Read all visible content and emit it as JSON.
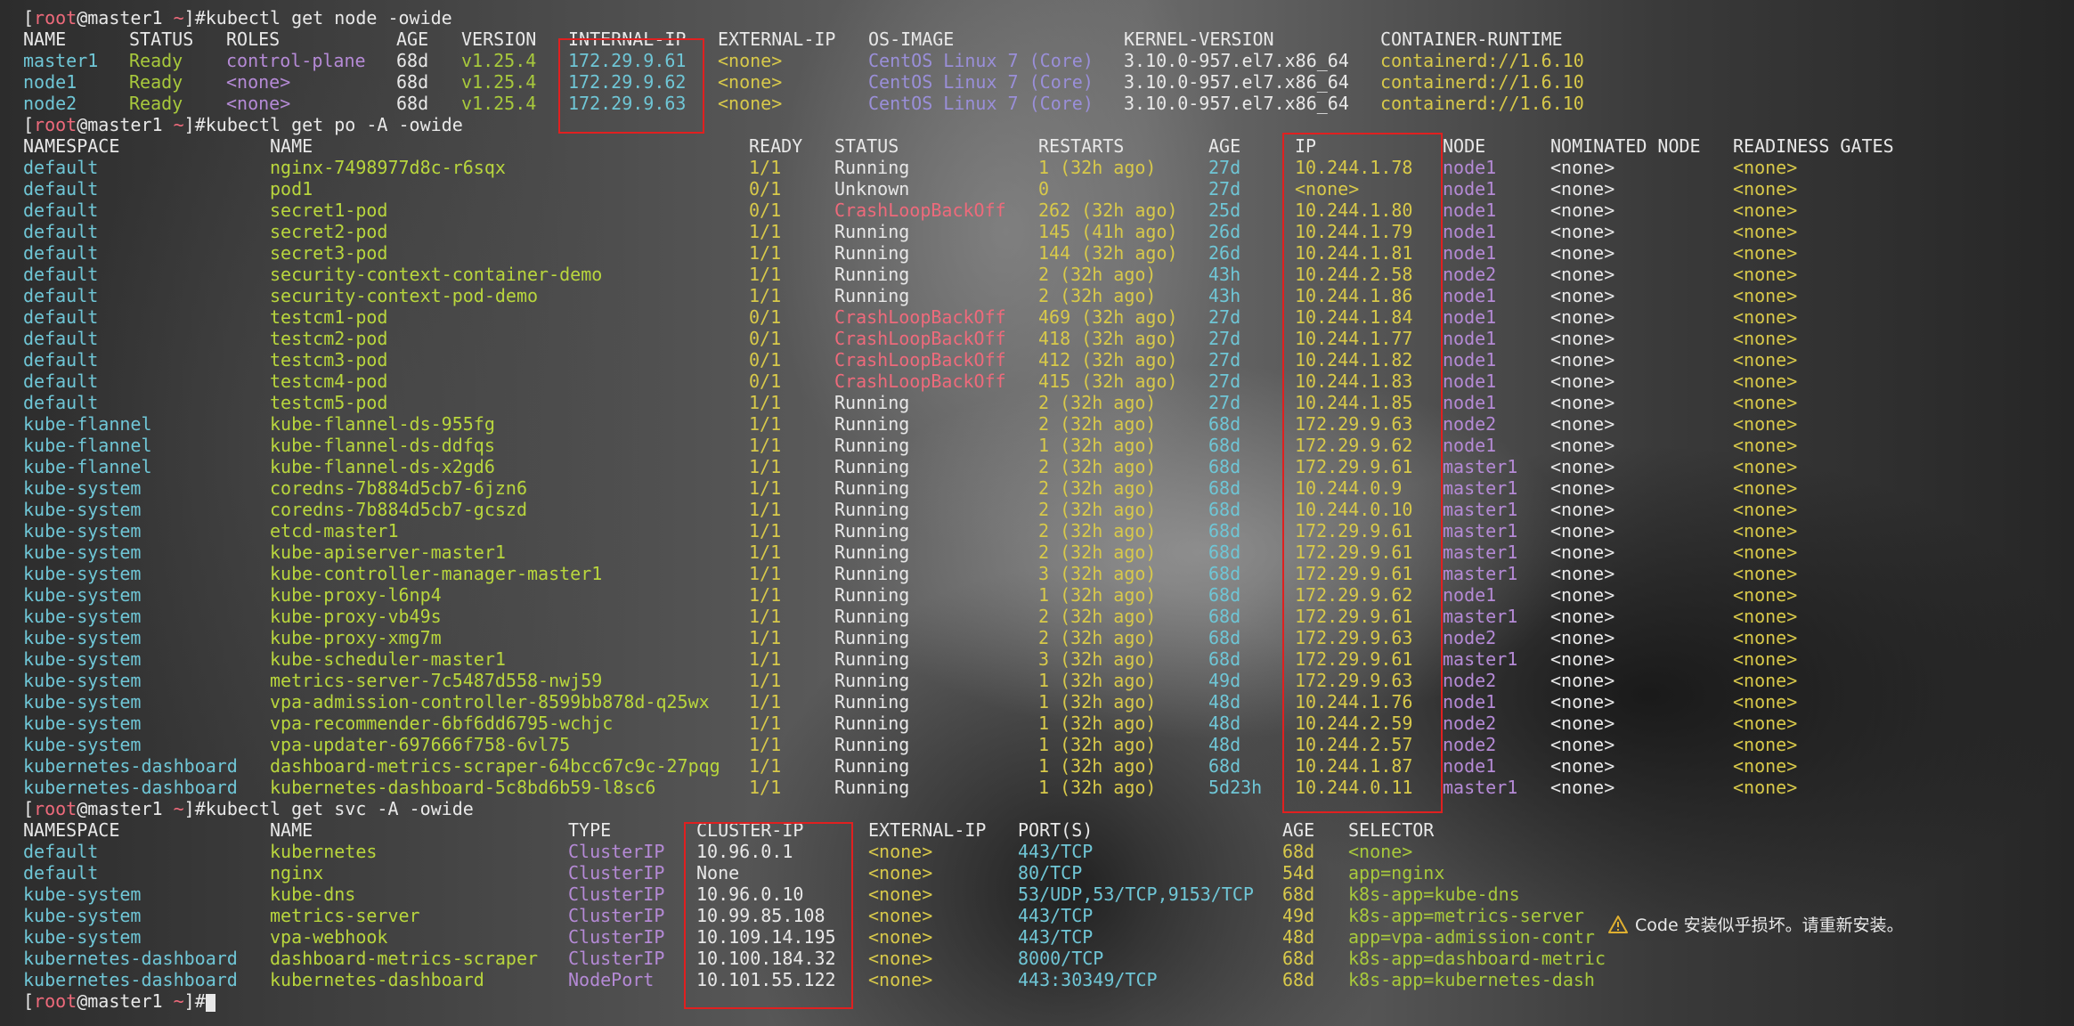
{
  "prompt": {
    "user": "root",
    "host": "master1",
    "dir": "~"
  },
  "cmd1": "kubectl get node -owide",
  "node_headers": [
    "NAME",
    "STATUS",
    "ROLES",
    "AGE",
    "VERSION",
    "INTERNAL-IP",
    "EXTERNAL-IP",
    "OS-IMAGE",
    "KERNEL-VERSION",
    "CONTAINER-RUNTIME"
  ],
  "nodes": [
    [
      "master1",
      "Ready",
      "control-plane",
      "68d",
      "v1.25.4",
      "172.29.9.61",
      "<none>",
      "CentOS Linux 7 (Core)",
      "3.10.0-957.el7.x86_64",
      "containerd://1.6.10"
    ],
    [
      "node1",
      "Ready",
      "<none>",
      "68d",
      "v1.25.4",
      "172.29.9.62",
      "<none>",
      "CentOS Linux 7 (Core)",
      "3.10.0-957.el7.x86_64",
      "containerd://1.6.10"
    ],
    [
      "node2",
      "Ready",
      "<none>",
      "68d",
      "v1.25.4",
      "172.29.9.63",
      "<none>",
      "CentOS Linux 7 (Core)",
      "3.10.0-957.el7.x86_64",
      "containerd://1.6.10"
    ]
  ],
  "cmd2": "kubectl get po -A -owide",
  "pod_headers": [
    "NAMESPACE",
    "NAME",
    "READY",
    "STATUS",
    "RESTARTS",
    "AGE",
    "IP",
    "NODE",
    "NOMINATED NODE",
    "READINESS GATES"
  ],
  "pods": [
    [
      "default",
      "nginx-7498977d8c-r6sqx",
      "1/1",
      "Running",
      "1 (32h ago)",
      "27d",
      "10.244.1.78",
      "node1",
      "<none>",
      "<none>"
    ],
    [
      "default",
      "pod1",
      "0/1",
      "Unknown",
      "0",
      "27d",
      "<none>",
      "node1",
      "<none>",
      "<none>"
    ],
    [
      "default",
      "secret1-pod",
      "0/1",
      "CrashLoopBackOff",
      "262 (32h ago)",
      "25d",
      "10.244.1.80",
      "node1",
      "<none>",
      "<none>"
    ],
    [
      "default",
      "secret2-pod",
      "1/1",
      "Running",
      "145 (41h ago)",
      "26d",
      "10.244.1.79",
      "node1",
      "<none>",
      "<none>"
    ],
    [
      "default",
      "secret3-pod",
      "1/1",
      "Running",
      "144 (32h ago)",
      "26d",
      "10.244.1.81",
      "node1",
      "<none>",
      "<none>"
    ],
    [
      "default",
      "security-context-container-demo",
      "1/1",
      "Running",
      "2 (32h ago)",
      "43h",
      "10.244.2.58",
      "node2",
      "<none>",
      "<none>"
    ],
    [
      "default",
      "security-context-pod-demo",
      "1/1",
      "Running",
      "2 (32h ago)",
      "43h",
      "10.244.1.86",
      "node1",
      "<none>",
      "<none>"
    ],
    [
      "default",
      "testcm1-pod",
      "0/1",
      "CrashLoopBackOff",
      "469 (32h ago)",
      "27d",
      "10.244.1.84",
      "node1",
      "<none>",
      "<none>"
    ],
    [
      "default",
      "testcm2-pod",
      "0/1",
      "CrashLoopBackOff",
      "418 (32h ago)",
      "27d",
      "10.244.1.77",
      "node1",
      "<none>",
      "<none>"
    ],
    [
      "default",
      "testcm3-pod",
      "0/1",
      "CrashLoopBackOff",
      "412 (32h ago)",
      "27d",
      "10.244.1.82",
      "node1",
      "<none>",
      "<none>"
    ],
    [
      "default",
      "testcm4-pod",
      "0/1",
      "CrashLoopBackOff",
      "415 (32h ago)",
      "27d",
      "10.244.1.83",
      "node1",
      "<none>",
      "<none>"
    ],
    [
      "default",
      "testcm5-pod",
      "1/1",
      "Running",
      "2 (32h ago)",
      "27d",
      "10.244.1.85",
      "node1",
      "<none>",
      "<none>"
    ],
    [
      "kube-flannel",
      "kube-flannel-ds-955fg",
      "1/1",
      "Running",
      "2 (32h ago)",
      "68d",
      "172.29.9.63",
      "node2",
      "<none>",
      "<none>"
    ],
    [
      "kube-flannel",
      "kube-flannel-ds-ddfqs",
      "1/1",
      "Running",
      "1 (32h ago)",
      "68d",
      "172.29.9.62",
      "node1",
      "<none>",
      "<none>"
    ],
    [
      "kube-flannel",
      "kube-flannel-ds-x2gd6",
      "1/1",
      "Running",
      "2 (32h ago)",
      "68d",
      "172.29.9.61",
      "master1",
      "<none>",
      "<none>"
    ],
    [
      "kube-system",
      "coredns-7b884d5cb7-6jzn6",
      "1/1",
      "Running",
      "2 (32h ago)",
      "68d",
      "10.244.0.9",
      "master1",
      "<none>",
      "<none>"
    ],
    [
      "kube-system",
      "coredns-7b884d5cb7-gcszd",
      "1/1",
      "Running",
      "2 (32h ago)",
      "68d",
      "10.244.0.10",
      "master1",
      "<none>",
      "<none>"
    ],
    [
      "kube-system",
      "etcd-master1",
      "1/1",
      "Running",
      "2 (32h ago)",
      "68d",
      "172.29.9.61",
      "master1",
      "<none>",
      "<none>"
    ],
    [
      "kube-system",
      "kube-apiserver-master1",
      "1/1",
      "Running",
      "2 (32h ago)",
      "68d",
      "172.29.9.61",
      "master1",
      "<none>",
      "<none>"
    ],
    [
      "kube-system",
      "kube-controller-manager-master1",
      "1/1",
      "Running",
      "3 (32h ago)",
      "68d",
      "172.29.9.61",
      "master1",
      "<none>",
      "<none>"
    ],
    [
      "kube-system",
      "kube-proxy-l6np4",
      "1/1",
      "Running",
      "1 (32h ago)",
      "68d",
      "172.29.9.62",
      "node1",
      "<none>",
      "<none>"
    ],
    [
      "kube-system",
      "kube-proxy-vb49s",
      "1/1",
      "Running",
      "2 (32h ago)",
      "68d",
      "172.29.9.61",
      "master1",
      "<none>",
      "<none>"
    ],
    [
      "kube-system",
      "kube-proxy-xmg7m",
      "1/1",
      "Running",
      "2 (32h ago)",
      "68d",
      "172.29.9.63",
      "node2",
      "<none>",
      "<none>"
    ],
    [
      "kube-system",
      "kube-scheduler-master1",
      "1/1",
      "Running",
      "3 (32h ago)",
      "68d",
      "172.29.9.61",
      "master1",
      "<none>",
      "<none>"
    ],
    [
      "kube-system",
      "metrics-server-7c5487d558-nwj59",
      "1/1",
      "Running",
      "1 (32h ago)",
      "49d",
      "172.29.9.63",
      "node2",
      "<none>",
      "<none>"
    ],
    [
      "kube-system",
      "vpa-admission-controller-8599bb878d-q25wx",
      "1/1",
      "Running",
      "1 (32h ago)",
      "48d",
      "10.244.1.76",
      "node1",
      "<none>",
      "<none>"
    ],
    [
      "kube-system",
      "vpa-recommender-6bf6dd6795-wchjc",
      "1/1",
      "Running",
      "1 (32h ago)",
      "48d",
      "10.244.2.59",
      "node2",
      "<none>",
      "<none>"
    ],
    [
      "kube-system",
      "vpa-updater-697666f758-6vl75",
      "1/1",
      "Running",
      "1 (32h ago)",
      "48d",
      "10.244.2.57",
      "node2",
      "<none>",
      "<none>"
    ],
    [
      "kubernetes-dashboard",
      "dashboard-metrics-scraper-64bcc67c9c-27pqg",
      "1/1",
      "Running",
      "1 (32h ago)",
      "68d",
      "10.244.1.87",
      "node1",
      "<none>",
      "<none>"
    ],
    [
      "kubernetes-dashboard",
      "kubernetes-dashboard-5c8bd6b59-l8sc6",
      "1/1",
      "Running",
      "1 (32h ago)",
      "5d23h",
      "10.244.0.11",
      "master1",
      "<none>",
      "<none>"
    ]
  ],
  "cmd3": "kubectl get svc -A -owide",
  "svc_headers": [
    "NAMESPACE",
    "NAME",
    "TYPE",
    "CLUSTER-IP",
    "EXTERNAL-IP",
    "PORT(S)",
    "AGE",
    "SELECTOR"
  ],
  "services": [
    [
      "default",
      "kubernetes",
      "ClusterIP",
      "10.96.0.1",
      "<none>",
      "443/TCP",
      "68d",
      "<none>"
    ],
    [
      "default",
      "nginx",
      "ClusterIP",
      "None",
      "<none>",
      "80/TCP",
      "54d",
      "app=nginx"
    ],
    [
      "kube-system",
      "kube-dns",
      "ClusterIP",
      "10.96.0.10",
      "<none>",
      "53/UDP,53/TCP,9153/TCP",
      "68d",
      "k8s-app=kube-dns"
    ],
    [
      "kube-system",
      "metrics-server",
      "ClusterIP",
      "10.99.85.108",
      "<none>",
      "443/TCP",
      "49d",
      "k8s-app=metrics-server"
    ],
    [
      "kube-system",
      "vpa-webhook",
      "ClusterIP",
      "10.109.14.195",
      "<none>",
      "443/TCP",
      "48d",
      "app=vpa-admission-contr"
    ],
    [
      "kubernetes-dashboard",
      "dashboard-metrics-scraper",
      "ClusterIP",
      "10.100.184.32",
      "<none>",
      "8000/TCP",
      "68d",
      "k8s-app=dashboard-metric"
    ],
    [
      "kubernetes-dashboard",
      "kubernetes-dashboard",
      "NodePort",
      "10.101.55.122",
      "<none>",
      "443:30349/TCP",
      "68d",
      "k8s-app=kubernetes-dash"
    ]
  ],
  "notice": {
    "text": "Code 安装似乎损坏。请重新安装。",
    "icon": "warning-icon"
  }
}
